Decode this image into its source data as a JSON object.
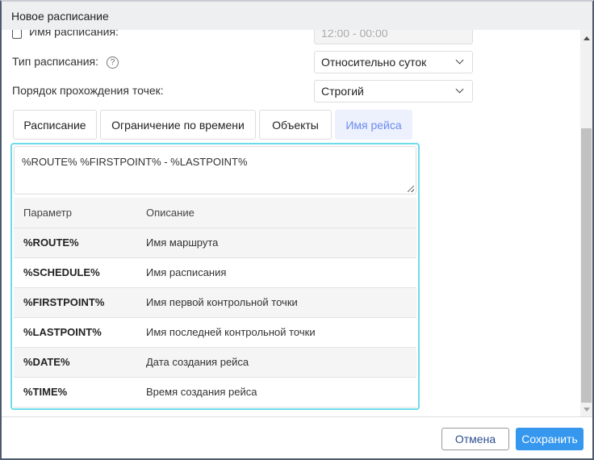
{
  "dialog": {
    "title": "Новое расписание"
  },
  "form": {
    "name_label": "Имя расписания:",
    "name_value": "12:00 - 00:00",
    "type_label": "Тип расписания:",
    "type_help": "?",
    "type_value": "Относительно суток",
    "order_label": "Порядок прохождения точек:",
    "order_value": "Строгий"
  },
  "tabs": [
    {
      "label": "Расписание"
    },
    {
      "label": "Ограничение по времени"
    },
    {
      "label": "Объекты"
    },
    {
      "label": "Имя рейса"
    }
  ],
  "template": {
    "value": "%ROUTE% %FIRSTPOINT% - %LASTPOINT%"
  },
  "table": {
    "headers": [
      "Параметр",
      "Описание"
    ],
    "rows": [
      {
        "param": "%ROUTE%",
        "desc": "Имя маршрута"
      },
      {
        "param": "%SCHEDULE%",
        "desc": "Имя расписания"
      },
      {
        "param": "%FIRSTPOINT%",
        "desc": "Имя первой контрольной точки"
      },
      {
        "param": "%LASTPOINT%",
        "desc": "Имя последней контрольной точки"
      },
      {
        "param": "%DATE%",
        "desc": "Дата создания рейса"
      },
      {
        "param": "%TIME%",
        "desc": "Время создания рейса"
      }
    ]
  },
  "footer": {
    "cancel": "Отмена",
    "save": "Сохранить"
  }
}
